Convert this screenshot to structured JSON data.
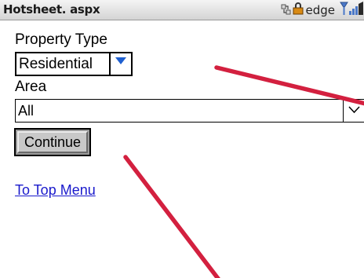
{
  "window": {
    "title": "Hotsheet. aspx",
    "network": "edge",
    "status_icons": [
      "traffic-arrows-icon",
      "lock-icon",
      "antenna-icon",
      "signal-bars-icon"
    ]
  },
  "form": {
    "property_type": {
      "label": "Property Type",
      "selected": "Residential"
    },
    "area": {
      "label": "Area",
      "selected": "All"
    },
    "continue_label": "Continue"
  },
  "links": {
    "top_menu": "To Top Menu"
  },
  "colors": {
    "link": "#1a1acc",
    "annotation": "#d3203f",
    "dropdown_arrow": "#1e5fd0",
    "signal": "#4a78c8"
  }
}
